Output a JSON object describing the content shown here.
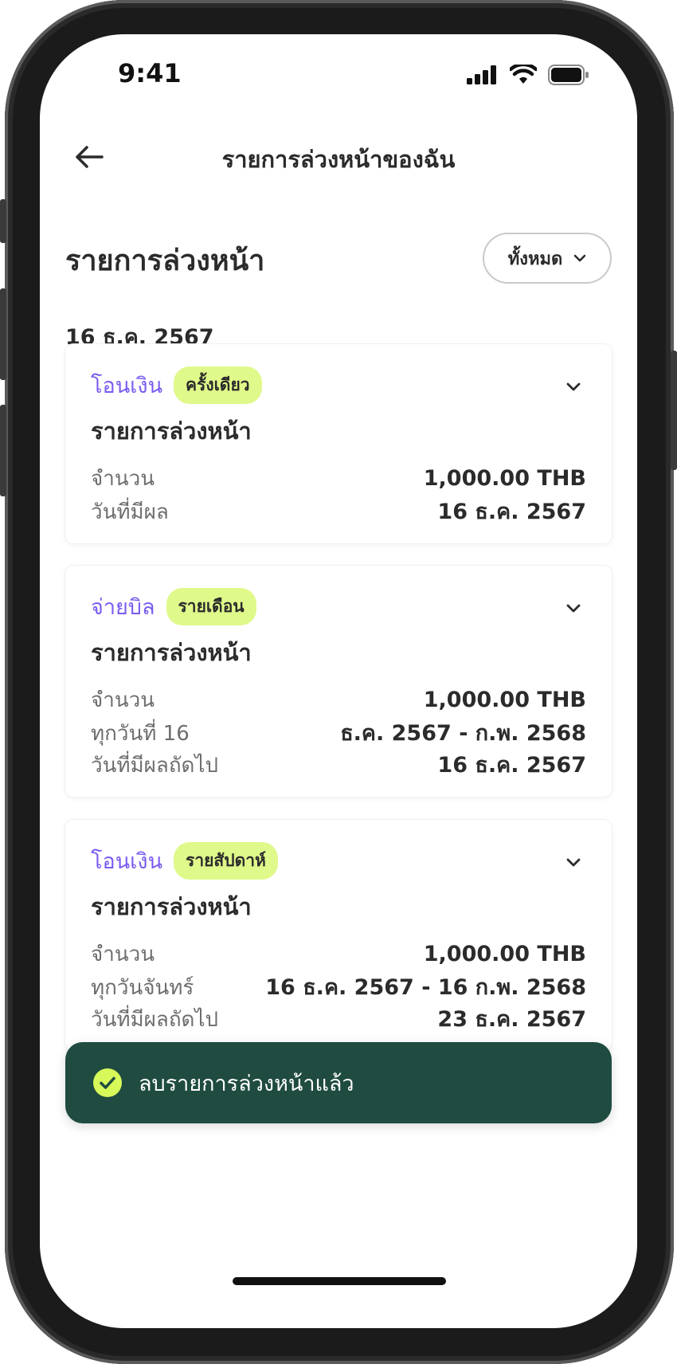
{
  "status_bar": {
    "time": "9:41"
  },
  "nav": {
    "title": "รายการล่วงหน้าของฉัน"
  },
  "section": {
    "title": "รายการล่วงหน้า",
    "filter_label": "ทั้งหมด"
  },
  "date_heading": "16 ธ.ค. 2567",
  "cards": [
    {
      "type": "โอนเงิน",
      "badge": "ครั้งเดียว",
      "title": "รายการล่วงหน้า",
      "rows": [
        {
          "label": "จำนวน",
          "value": "1,000.00 THB"
        },
        {
          "label": "วันที่มีผล",
          "value": "16 ธ.ค. 2567"
        }
      ]
    },
    {
      "type": "จ่ายบิล",
      "badge": "รายเดือน",
      "title": "รายการล่วงหน้า",
      "rows": [
        {
          "label": "จำนวน",
          "value": "1,000.00 THB"
        },
        {
          "label": "ทุกวันที่ 16",
          "value": "ธ.ค. 2567 - ก.พ. 2568"
        },
        {
          "label": "วันที่มีผลถัดไป",
          "value": "16 ธ.ค. 2567"
        }
      ]
    },
    {
      "type": "โอนเงิน",
      "badge": "รายสัปดาห์",
      "title": "รายการล่วงหน้า",
      "rows": [
        {
          "label": "จำนวน",
          "value": "1,000.00 THB"
        },
        {
          "label": "ทุกวันจันทร์",
          "value": "16 ธ.ค. 2567 - 16 ก.พ. 2568"
        },
        {
          "label": "วันที่มีผลถัดไป",
          "value": "23 ธ.ค. 2567"
        }
      ]
    }
  ],
  "toast": {
    "text": "ลบรายการล่วงหน้าแล้ว"
  },
  "colors": {
    "accent": "#7b5cf0",
    "badge_bg": "#dff98a",
    "toast_bg": "#1f4b40",
    "toast_check": "#d7f95a"
  },
  "icons": {
    "back": "arrow-left-icon",
    "filter": "chevron-down-icon",
    "card_expand": "chevron-down-icon",
    "toast": "check-circle-icon"
  }
}
